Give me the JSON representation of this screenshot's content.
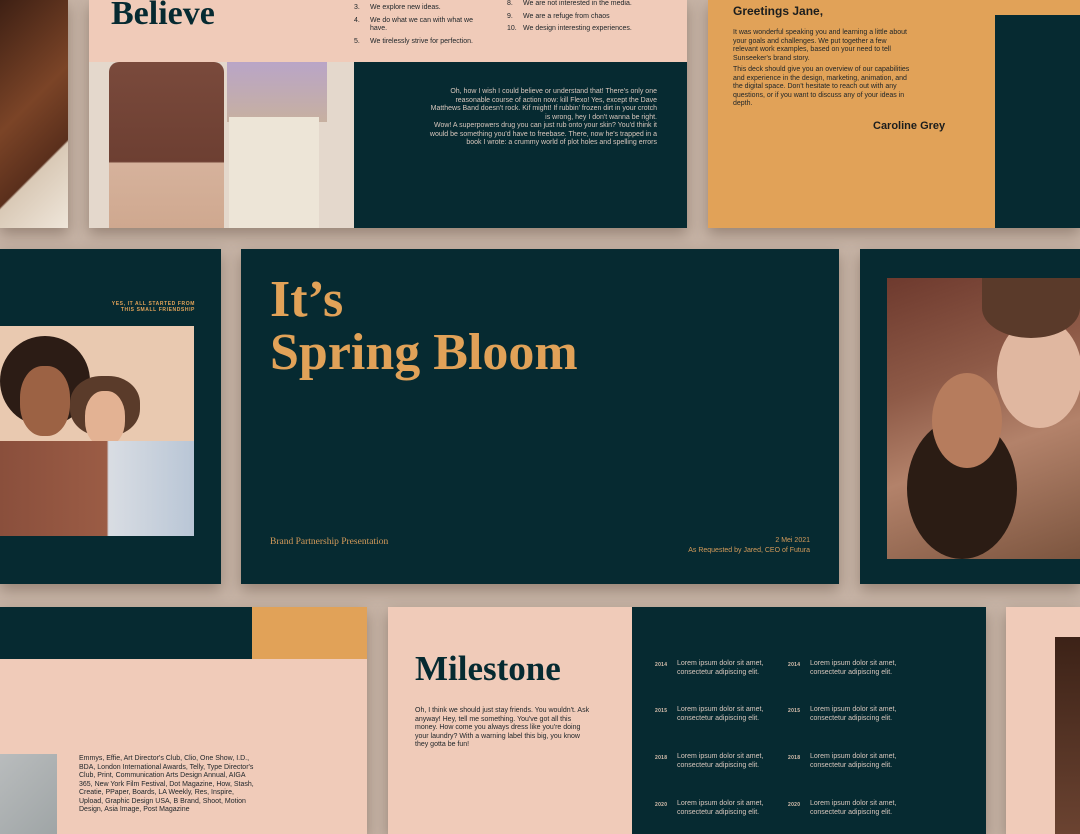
{
  "slide_believe": {
    "title": "Believe",
    "list_left": [
      {
        "num": "3.",
        "text": "We explore new ideas."
      },
      {
        "num": "4.",
        "text": "We do what we can with what we have."
      },
      {
        "num": "5.",
        "text": "We tirelessly strive for perfection."
      }
    ],
    "list_right": [
      {
        "num": "8.",
        "text": "We are not interested in the media."
      },
      {
        "num": "9.",
        "text": "We are a refuge from chaos"
      },
      {
        "num": "10.",
        "text": "We design interesting experiences."
      }
    ],
    "paragraph1": "Oh, how I wish I could believe or understand that! There's only one reasonable course of action now: kill Flexo! Yes, except the Dave Matthews Band doesn't rock. Kif might! If rubbin' frozen dirt in your crotch is wrong, hey I don't wanna be right.",
    "paragraph2": "Wow! A superpowers drug you can just rub onto your skin? You'd think it would be something you'd have to freebase. There, now he's trapped in a book I wrote: a crummy world of plot holes and spelling errors"
  },
  "slide_greeting": {
    "heading": "Greetings Jane,",
    "para1": "It was wonderful speaking you and learning a little about your goals and challenges. We put together a few relevant work examples, based on your need to tell Sunseeker's brand story.",
    "para2": "This deck should give you an overview of our capabilities and experience in the design, marketing, animation, and the digital space. Don't hesitate to reach out with any questions, or if you want to discuss any of your ideas in depth.",
    "signature": "Caroline Grey"
  },
  "slide_friendship": {
    "caption_line1": "YES, IT ALL STARTED FROM",
    "caption_line2": "THIS SMALL FRIENDSHIP"
  },
  "slide_cover": {
    "title_line1": "It’s",
    "title_line2": "Spring Bloom",
    "subtitle": "Brand Partnership Presentation",
    "date": "2 Mei 2021",
    "requested": "As Requested by Jared, CEO of Futura"
  },
  "slide_awards": {
    "text": "Emmys, Effie, Art Director's Club, Clio, One Show, I.D., BDA, London International Awards, Telly, Type Director's Club, Print, Communication Arts Design Annual, AIGA 365, New York Film Festival, Dot Magazine, How, Stash, Creatie, PPaper, Boards, LA Weekly, Res, Inspire, Upload, Graphic Design USA, B Brand, Shoot, Motion Design, Asia Image, Post Magazine"
  },
  "slide_milestone": {
    "title": "Milestone",
    "intro": "Oh, I think we should just stay friends. You wouldn't. Ask anyway! Hey, tell me something. You've got all this money. How come you always dress like you're doing your laundry? With a warning label this big, you know they gotta be fun!",
    "rows": [
      {
        "year_left": "2014",
        "text_left": "Lorem ipsum dolor sit amet, consectetur adipiscing elit.",
        "year_right": "2014",
        "text_right": "Lorem ipsum dolor sit amet, consectetur adipiscing elit."
      },
      {
        "year_left": "2015",
        "text_left": "Lorem ipsum dolor sit amet, consectetur adipiscing elit.",
        "year_right": "2015",
        "text_right": "Lorem ipsum dolor sit amet, consectetur adipiscing elit."
      },
      {
        "year_left": "2018",
        "text_left": "Lorem ipsum dolor sit amet, consectetur adipiscing elit.",
        "year_right": "2018",
        "text_right": "Lorem ipsum dolor sit amet, consectetur adipiscing elit."
      },
      {
        "year_left": "2020",
        "text_left": "Lorem ipsum dolor sit amet, consectetur adipiscing elit.",
        "year_right": "2020",
        "text_right": "Lorem ipsum dolor sit amet, consectetur adipiscing elit."
      }
    ]
  },
  "colors": {
    "teal": "#062a31",
    "pink": "#f0cbb9",
    "orange": "#e1a258",
    "background": "#c7b4a6"
  }
}
